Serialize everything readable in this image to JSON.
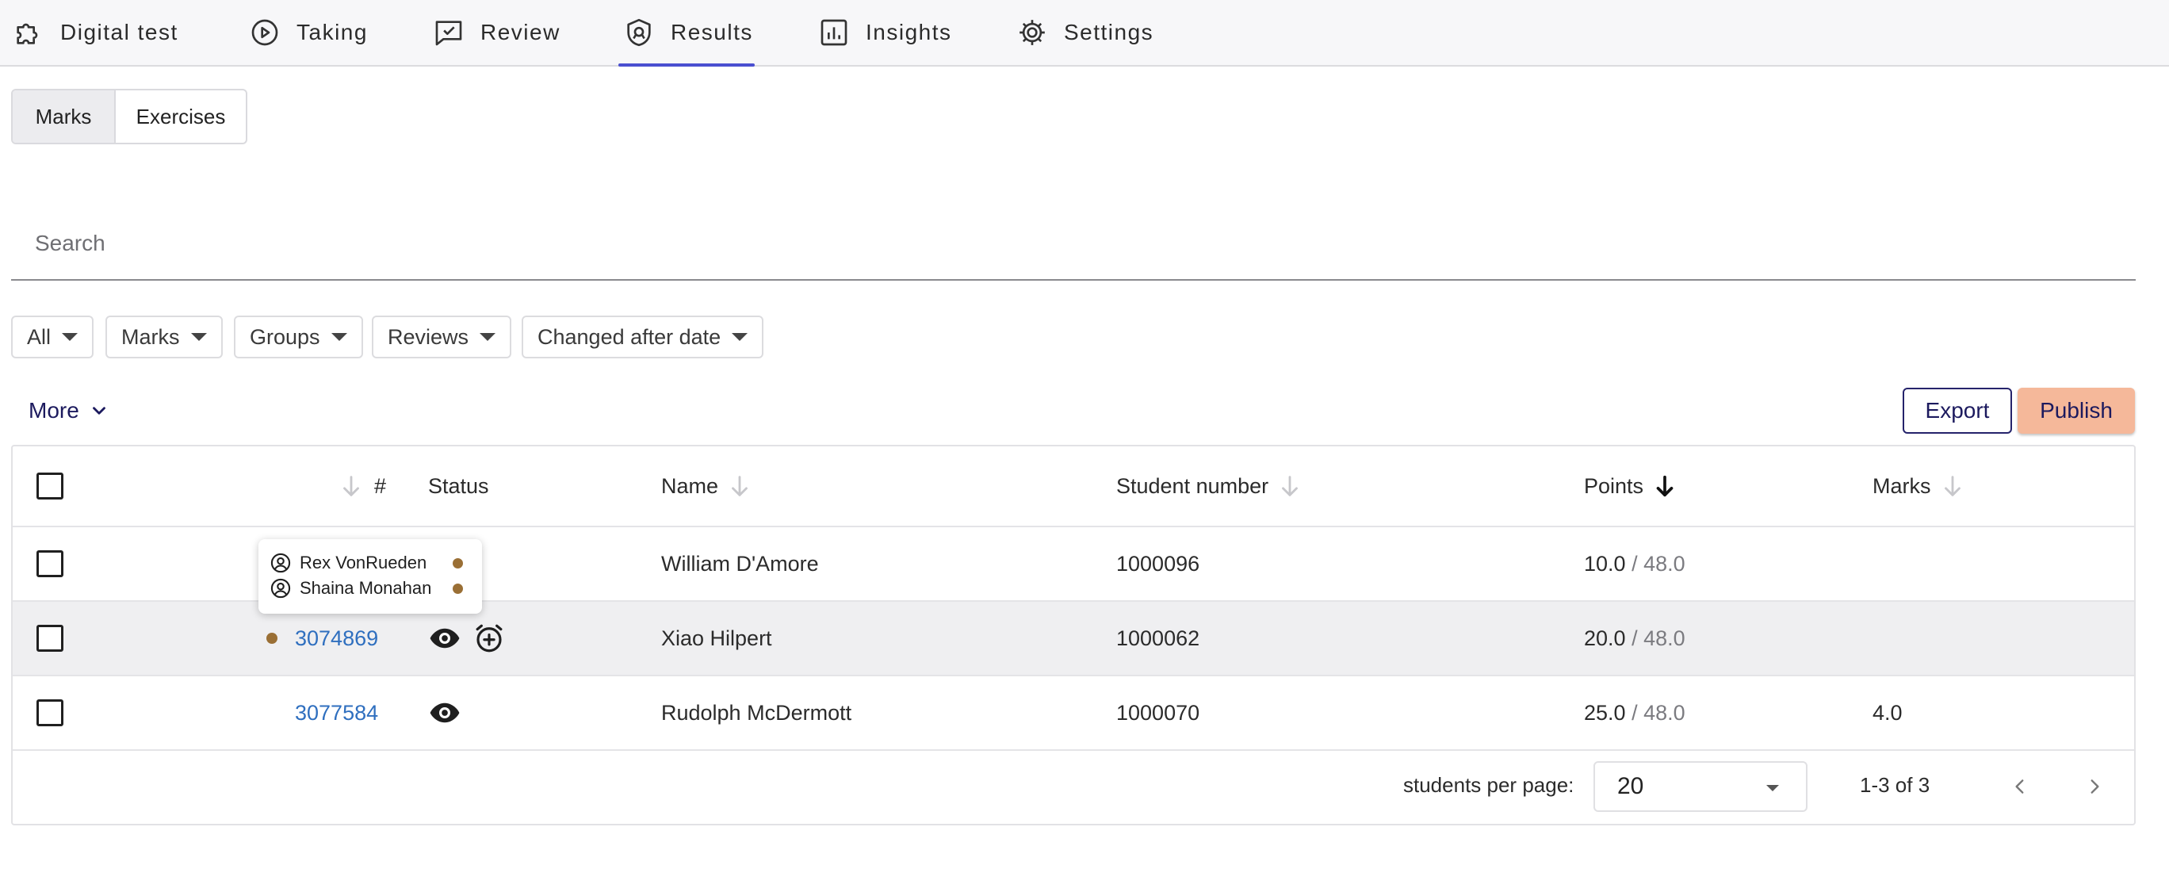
{
  "nav": {
    "items": [
      {
        "label": "Digital test",
        "icon": "puzzle-icon"
      },
      {
        "label": "Taking",
        "icon": "play-circle-icon"
      },
      {
        "label": "Review",
        "icon": "comment-check-icon"
      },
      {
        "label": "Results",
        "icon": "shield-icon",
        "active": true
      },
      {
        "label": "Insights",
        "icon": "bar-chart-icon"
      },
      {
        "label": "Settings",
        "icon": "gear-icon"
      }
    ]
  },
  "tabs": {
    "marks": "Marks",
    "exercises": "Exercises",
    "active": "Marks"
  },
  "search": {
    "placeholder": "Search",
    "value": ""
  },
  "filters": [
    "All",
    "Marks",
    "Groups",
    "Reviews",
    "Changed after date"
  ],
  "actions": {
    "more": "More",
    "export": "Export",
    "publish": "Publish"
  },
  "table": {
    "columns": {
      "number": "#",
      "status": "Status",
      "name": "Name",
      "student_number": "Student number",
      "points": "Points",
      "marks": "Marks"
    },
    "sorted_by": "Points",
    "rows": [
      {
        "number": "",
        "name": "William D'Amore",
        "student_number": "1000096",
        "points": "10.0",
        "total": " / 48.0",
        "marks": "",
        "status_icons": []
      },
      {
        "number": "3074869",
        "name": "Xiao Hilpert",
        "student_number": "1000062",
        "points": "20.0",
        "total": " / 48.0",
        "marks": "",
        "status_icons": [
          "eye-icon",
          "alarm-plus-icon"
        ],
        "dot": true
      },
      {
        "number": "3077584",
        "name": "Rudolph McDermott",
        "student_number": "1000070",
        "points": "25.0",
        "total": " / 48.0",
        "marks": "4.0",
        "status_icons": [
          "eye-icon"
        ]
      }
    ]
  },
  "tooltip": {
    "reviewers": [
      "Rex VonRueden",
      "Shaina Monahan"
    ]
  },
  "footer": {
    "per_page_label": "students per page:",
    "per_page_value": "20",
    "range": "1-3 of 3"
  },
  "colors": {
    "accent": "#4a4fd0",
    "publish_bg": "#f5b89a",
    "brand_text": "#1c1a5e",
    "link": "#2f6fbf",
    "status_dot": "#9a6f35"
  }
}
